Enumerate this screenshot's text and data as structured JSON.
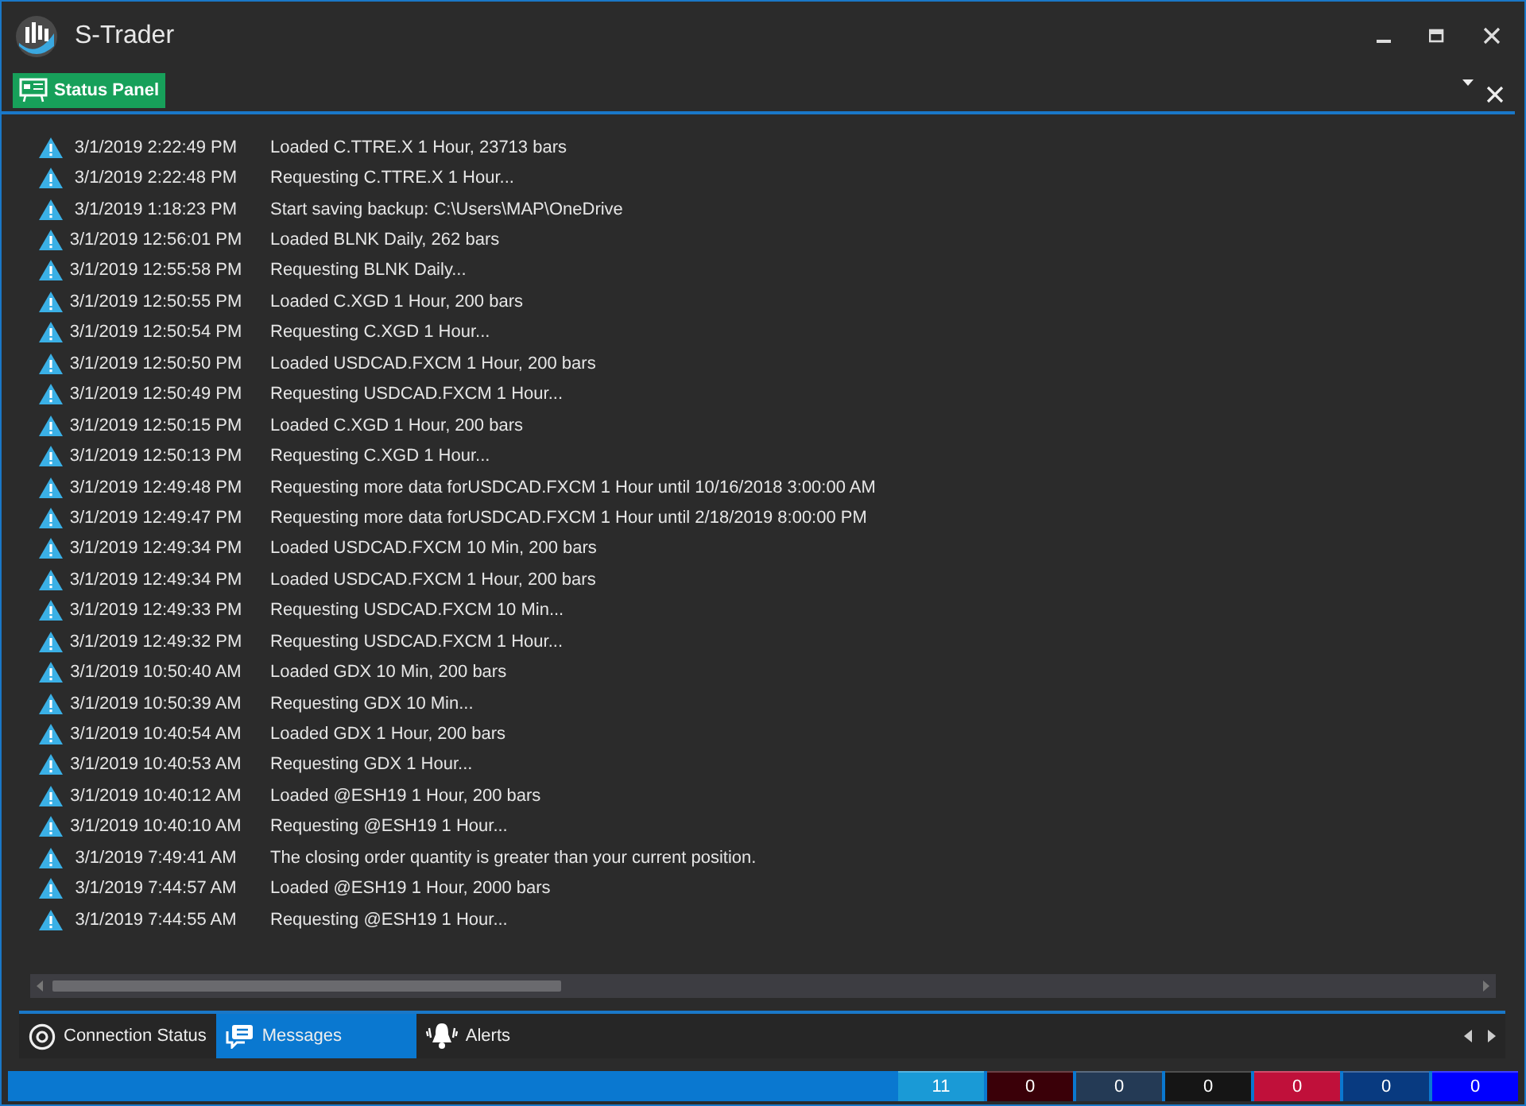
{
  "window": {
    "title": "S-Trader"
  },
  "panel": {
    "title": "Status Panel"
  },
  "messages": [
    {
      "time": "3/1/2019 2:22:49 PM",
      "text": "Loaded C.TTRE.X 1 Hour, 23713 bars"
    },
    {
      "time": "3/1/2019 2:22:48 PM",
      "text": "Requesting C.TTRE.X 1 Hour..."
    },
    {
      "time": "3/1/2019 1:18:23 PM",
      "text": "Start saving backup: C:\\Users\\MAP\\OneDrive"
    },
    {
      "time": "3/1/2019 12:56:01 PM",
      "text": "Loaded BLNK Daily, 262 bars"
    },
    {
      "time": "3/1/2019 12:55:58 PM",
      "text": "Requesting BLNK Daily..."
    },
    {
      "time": "3/1/2019 12:50:55 PM",
      "text": "Loaded C.XGD 1 Hour, 200 bars"
    },
    {
      "time": "3/1/2019 12:50:54 PM",
      "text": "Requesting C.XGD 1 Hour..."
    },
    {
      "time": "3/1/2019 12:50:50 PM",
      "text": "Loaded USDCAD.FXCM 1 Hour, 200 bars"
    },
    {
      "time": "3/1/2019 12:50:49 PM",
      "text": "Requesting USDCAD.FXCM 1 Hour..."
    },
    {
      "time": "3/1/2019 12:50:15 PM",
      "text": "Loaded C.XGD 1 Hour, 200 bars"
    },
    {
      "time": "3/1/2019 12:50:13 PM",
      "text": "Requesting C.XGD 1 Hour..."
    },
    {
      "time": "3/1/2019 12:49:48 PM",
      "text": "Requesting more data forUSDCAD.FXCM 1 Hour until 10/16/2018 3:00:00 AM"
    },
    {
      "time": "3/1/2019 12:49:47 PM",
      "text": "Requesting more data forUSDCAD.FXCM 1 Hour until 2/18/2019 8:00:00 PM"
    },
    {
      "time": "3/1/2019 12:49:34 PM",
      "text": "Loaded USDCAD.FXCM 10 Min, 200 bars"
    },
    {
      "time": "3/1/2019 12:49:34 PM",
      "text": "Loaded USDCAD.FXCM 1 Hour, 200 bars"
    },
    {
      "time": "3/1/2019 12:49:33 PM",
      "text": "Requesting USDCAD.FXCM 10 Min..."
    },
    {
      "time": "3/1/2019 12:49:32 PM",
      "text": "Requesting USDCAD.FXCM 1 Hour..."
    },
    {
      "time": "3/1/2019 10:50:40 AM",
      "text": "Loaded GDX 10 Min, 200 bars"
    },
    {
      "time": "3/1/2019 10:50:39 AM",
      "text": "Requesting GDX 10 Min..."
    },
    {
      "time": "3/1/2019 10:40:54 AM",
      "text": "Loaded GDX 1 Hour, 200 bars"
    },
    {
      "time": "3/1/2019 10:40:53 AM",
      "text": "Requesting GDX 1 Hour..."
    },
    {
      "time": "3/1/2019 10:40:12 AM",
      "text": "Loaded @ESH19 1 Hour, 200 bars"
    },
    {
      "time": "3/1/2019 10:40:10 AM",
      "text": "Requesting @ESH19 1 Hour..."
    },
    {
      "time": "3/1/2019 7:49:41 AM",
      "text": "The closing order quantity is greater than your current position."
    },
    {
      "time": "3/1/2019 7:44:57 AM",
      "text": "Loaded @ESH19 1 Hour, 2000 bars"
    },
    {
      "time": "3/1/2019 7:44:55 AM",
      "text": "Requesting @ESH19 1 Hour..."
    }
  ],
  "tabs": [
    {
      "label": "Connection Status",
      "kind": "connection",
      "selected": false
    },
    {
      "label": "Messages",
      "kind": "messages",
      "selected": true
    },
    {
      "label": "Alerts",
      "kind": "alerts",
      "selected": false
    }
  ],
  "status_bar": [
    {
      "count": "11",
      "color": "#1a9ad6"
    },
    {
      "count": "0",
      "color": "#3a0008"
    },
    {
      "count": "0",
      "color": "#243a55"
    },
    {
      "count": "0",
      "color": "#151515"
    },
    {
      "count": "0",
      "color": "#c0103a"
    },
    {
      "count": "0",
      "color": "#083a80"
    },
    {
      "count": "0",
      "color": "#0000ff"
    }
  ]
}
